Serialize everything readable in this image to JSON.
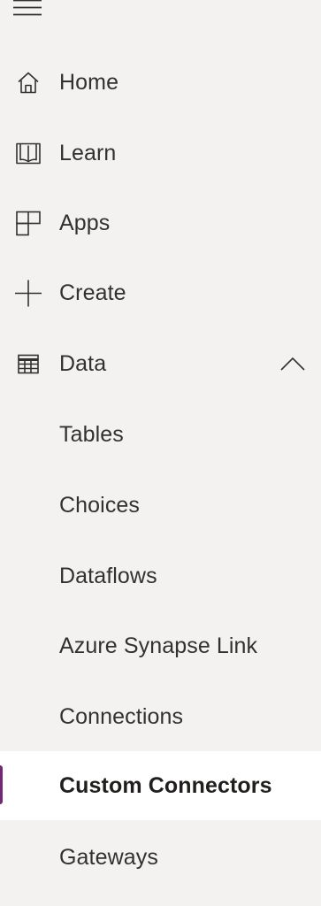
{
  "theme": {
    "background": "#f3f2f1",
    "selected_background": "#ffffff",
    "accent": "#742774",
    "text": "#323130"
  },
  "nav": {
    "menu_icon": "hamburger-menu-icon",
    "items": [
      {
        "label": "Home",
        "icon": "home-icon"
      },
      {
        "label": "Learn",
        "icon": "book-icon"
      },
      {
        "label": "Apps",
        "icon": "apps-icon"
      },
      {
        "label": "Create",
        "icon": "plus-icon"
      },
      {
        "label": "Data",
        "icon": "table-icon",
        "expanded": true,
        "chevron": "chevron-up-icon"
      }
    ],
    "data_children": [
      {
        "label": "Tables"
      },
      {
        "label": "Choices"
      },
      {
        "label": "Dataflows"
      },
      {
        "label": "Azure Synapse Link"
      },
      {
        "label": "Connections"
      },
      {
        "label": "Custom Connectors",
        "selected": true
      },
      {
        "label": "Gateways"
      }
    ]
  }
}
